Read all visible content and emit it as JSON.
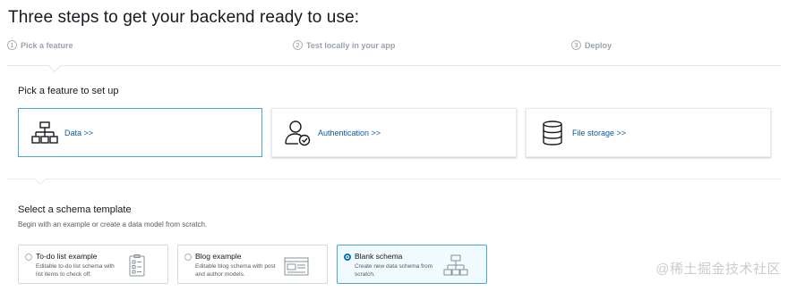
{
  "page": {
    "title": "Three steps to get your backend ready to use:"
  },
  "steps": [
    {
      "num": "1",
      "label": "Pick a feature"
    },
    {
      "num": "2",
      "label": "Test locally in your app"
    },
    {
      "num": "3",
      "label": "Deploy"
    }
  ],
  "features": {
    "title": "Pick a feature to set up",
    "cards": [
      {
        "label": "Data >>",
        "icon": "hierarchy-icon"
      },
      {
        "label": "Authentication >>",
        "icon": "user-check-icon"
      },
      {
        "label": "File storage >>",
        "icon": "database-icon"
      }
    ]
  },
  "schema": {
    "title": "Select a schema template",
    "description": "Begin with an example or create a data model from scratch.",
    "options": [
      {
        "name": "To-do list example",
        "description": "Editable to-do list schema with list items to check off.",
        "selected": false,
        "icon": "checklist-icon"
      },
      {
        "name": "Blog example",
        "description": "Editable blog schema with post and author models.",
        "selected": false,
        "icon": "blog-layout-icon"
      },
      {
        "name": "Blank schema",
        "description": "Create new data schema from scratch.",
        "selected": true,
        "icon": "hierarchy-icon"
      }
    ]
  },
  "watermark": "@稀土掘金技术社区",
  "colors": {
    "link": "#0a5aa5",
    "selected_border": "#44a8dd",
    "radio_selected": "#0073bb"
  }
}
